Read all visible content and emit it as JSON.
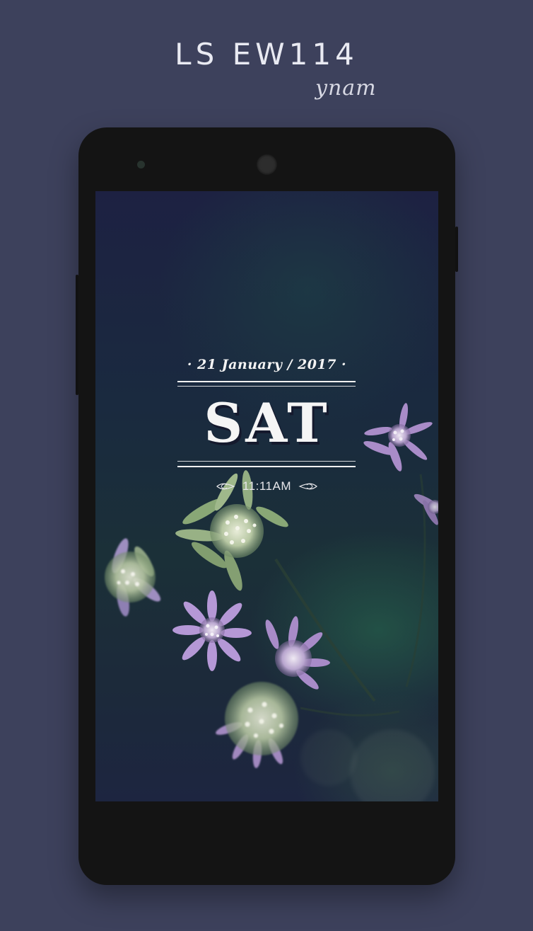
{
  "header": {
    "title": "LS EW114",
    "author": "ynam"
  },
  "lockscreen": {
    "date": "· 21 January / 2017 ·",
    "day": "SAT",
    "time": "11:11AM"
  },
  "colors": {
    "background": "#3d415c",
    "phone_body": "#141414",
    "text_light": "#f3f3f3"
  },
  "icons": {
    "ornament_left": "leaf-ornament-icon",
    "ornament_right": "leaf-ornament-icon"
  }
}
